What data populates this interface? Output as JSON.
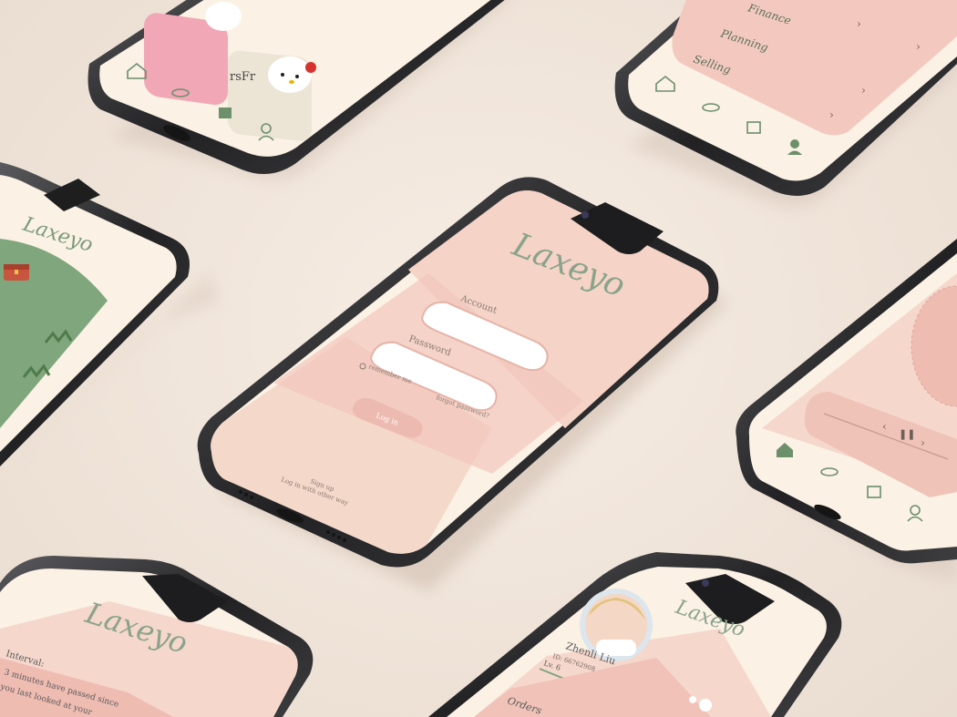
{
  "app": {
    "logo_text": "Laxeyo"
  },
  "login_screen": {
    "account_label": "Account",
    "password_label": "Password",
    "remember_me": "remember me",
    "forgot_password": "forgot password?",
    "login_button": "Log in",
    "sign_up": "Sign up",
    "other_login": "Log in with other way"
  },
  "settings_screen": {
    "items": [
      "Finance",
      "Planning",
      "Selling"
    ]
  },
  "interval_screen": {
    "title": "Interval:",
    "line1": "3 minutes have passed since",
    "line2": "you last looked at your"
  },
  "profile_screen": {
    "user_name": "Zhenli Liu",
    "user_id": "ID: 66762908",
    "level": "Lv. 6",
    "orders_label": "Orders"
  },
  "shop_screen": {
    "partial_label": "rsFr"
  },
  "colors": {
    "background": "#f1e6dc",
    "screen_cream": "#fbf1e4",
    "screen_pink": "#f5d7cc",
    "accent_pink": "#efbcb2",
    "button_pink": "#ecbab0",
    "green_field": "#7fa67c",
    "phone_frame": "#2b2b2d"
  },
  "icons": [
    "home-icon",
    "eye-icon",
    "bag-icon",
    "user-icon",
    "chest-icon",
    "prev-icon",
    "pause-icon",
    "next-icon"
  ]
}
